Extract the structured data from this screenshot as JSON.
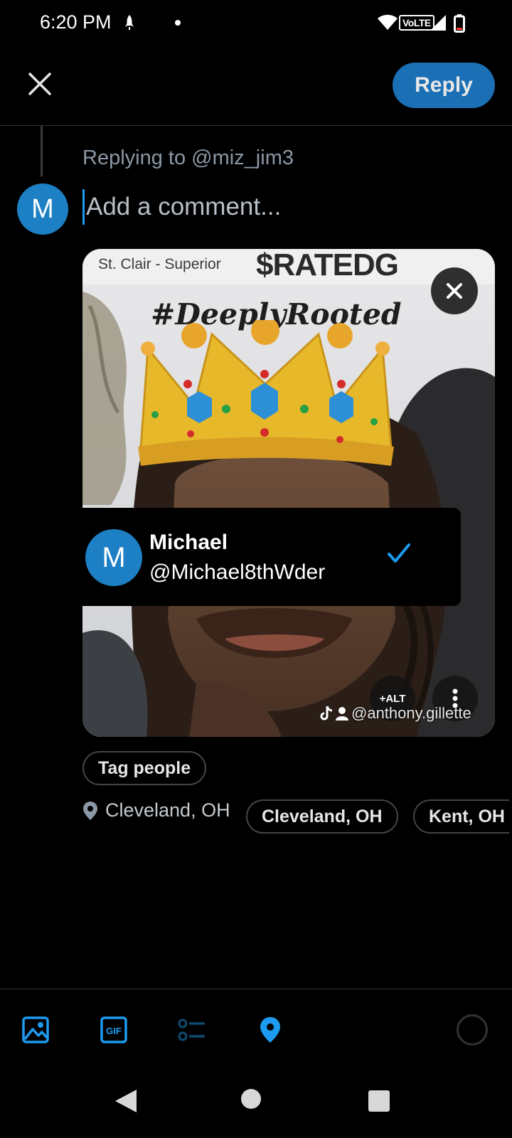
{
  "status_bar": {
    "time": "6:20 PM",
    "network": "VoLTE"
  },
  "header": {
    "close_icon": "close-icon",
    "reply_label": "Reply"
  },
  "compose": {
    "replying_to": "Replying to @miz_jim3",
    "avatar_initial": "M",
    "placeholder": "Add a comment..."
  },
  "media": {
    "photo_text": {
      "label": "St. Clair - Superior",
      "headline": "$RATEDG",
      "hashtag": "#DeeplyRooted",
      "watermark": "@anthony.gillette"
    },
    "alt_label": "+ALT"
  },
  "tag_suggestion": {
    "avatar_initial": "M",
    "name": "Michael",
    "handle": "@Michael8thWder",
    "selected": true
  },
  "tag_people_label": "Tag people",
  "location": {
    "current": "Cleveland, OH",
    "suggestions": [
      "Cleveland, OH",
      "Kent, OH"
    ]
  },
  "toolbar": {
    "icons": [
      "image-icon",
      "gif-icon",
      "poll-icon",
      "location-icon"
    ],
    "accent": "#1d9bf0"
  },
  "colors": {
    "background": "#000000",
    "reply_button": "#1a6fb5",
    "avatar": "#1d7fc4"
  }
}
